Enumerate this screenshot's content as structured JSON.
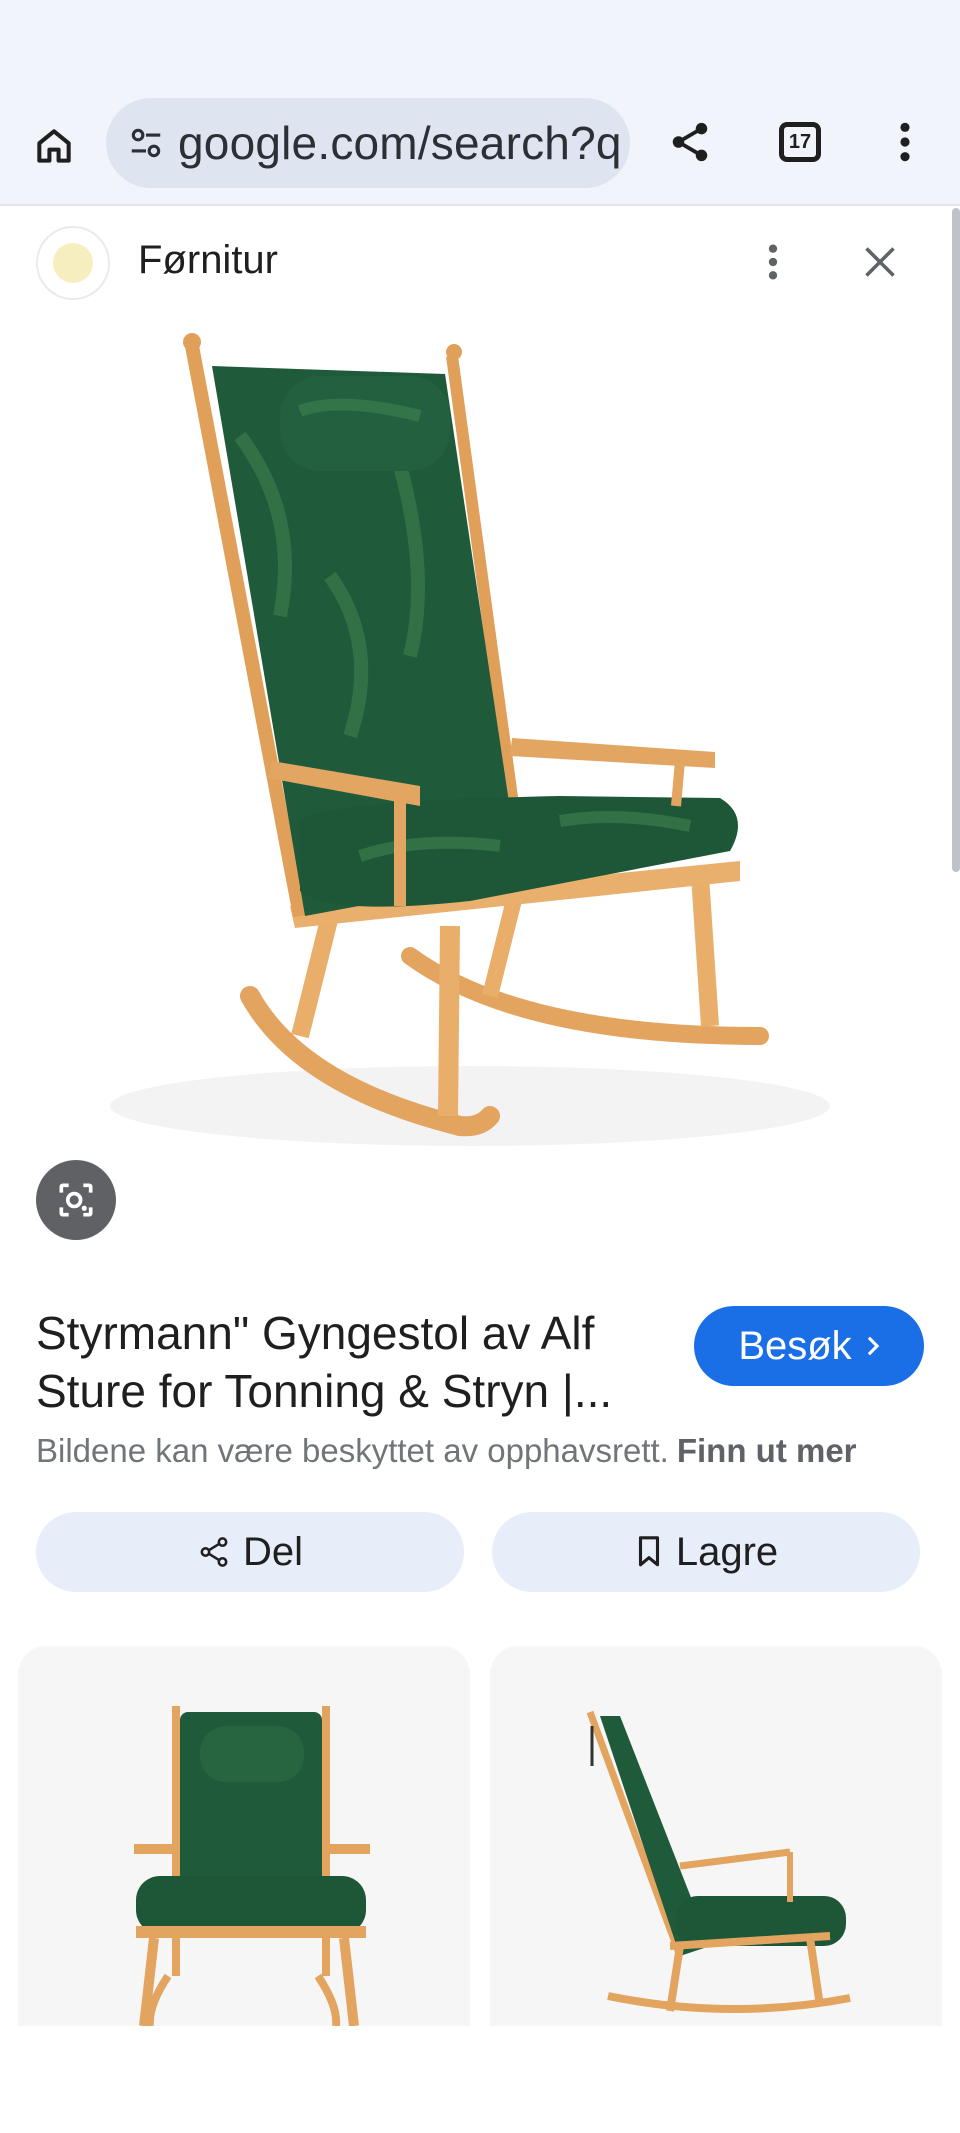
{
  "browser": {
    "url": "google.com/search?q",
    "tab_count": "17"
  },
  "panel": {
    "site_name": "Førnitur"
  },
  "result": {
    "title": "Styrmann\" Gyngestol av Alf Sture for Tonning & Stryn |...",
    "visit_label": "Besøk",
    "copyright_text": "Bildene kan være beskyttet av opphavsrett.",
    "learn_more": "Finn ut mer"
  },
  "actions": {
    "share_label": "Del",
    "save_label": "Lagre"
  },
  "colors": {
    "accent": "#1a6ee6",
    "toolbar_bg": "#f1f4fb",
    "chip_bg": "#e7eefa",
    "cushion": "#1f5a3a",
    "wood": "#e3a460"
  },
  "icons": {
    "home": "home-icon",
    "site_info": "tune-icon",
    "share": "share-icon",
    "tabs": "tab-switcher-icon",
    "menu": "more-vert-icon",
    "close": "close-icon",
    "lens": "lens-icon",
    "save": "bookmark-icon"
  }
}
